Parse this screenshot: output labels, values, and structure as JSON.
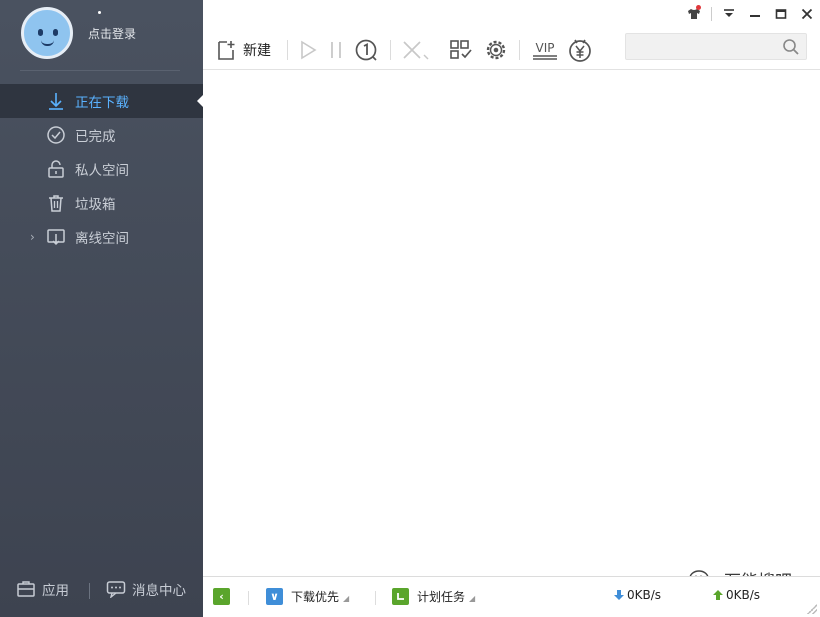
{
  "user": {
    "dot": "•",
    "login_label": "点击登录"
  },
  "sidebar": {
    "items": [
      {
        "label": "正在下载",
        "icon": "download-arrow-icon",
        "active": true
      },
      {
        "label": "已完成",
        "icon": "check-circle-icon"
      },
      {
        "label": "私人空间",
        "icon": "lock-icon"
      },
      {
        "label": "垃圾箱",
        "icon": "trash-icon"
      },
      {
        "label": "离线空间",
        "icon": "cloud-download-icon"
      }
    ],
    "footer": {
      "apps_label": "应用",
      "messages_label": "消息中心"
    }
  },
  "toolbar": {
    "new_label": "新建",
    "vip_label": "VIP",
    "search_placeholder": ""
  },
  "statusbar": {
    "priority_label": "下载优先",
    "schedule_label": "计划任务",
    "down_speed": "0KB/s",
    "up_speed": "0KB/s"
  },
  "watermark": {
    "text": "万能搜吧"
  },
  "colors": {
    "sidebar": "#434a56",
    "active_text": "#5ab2ff",
    "accent_green": "#5aa52c",
    "accent_blue": "#3f8ed8"
  }
}
